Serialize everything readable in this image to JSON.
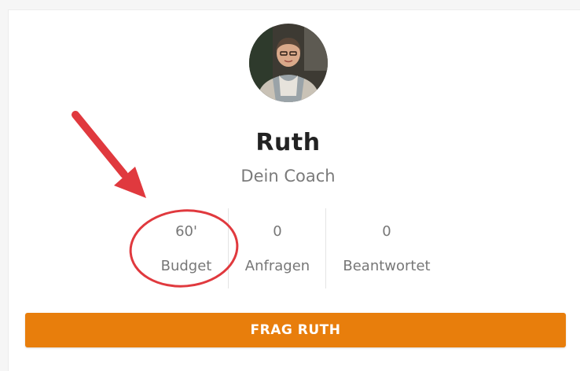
{
  "coach": {
    "name": "Ruth",
    "role": "Dein Coach"
  },
  "stats": [
    {
      "value": "60'",
      "label": "Budget"
    },
    {
      "value": "0",
      "label": "Anfragen"
    },
    {
      "value": "0",
      "label": "Beantwortet"
    }
  ],
  "cta": {
    "label": "FRAG RUTH"
  },
  "colors": {
    "accent": "#e87e0c",
    "annotation": "#e0393e"
  },
  "icons": {
    "avatar": "coach-avatar-photo",
    "annotation_arrow": "red-arrow-icon",
    "annotation_circle": "red-circle-highlight"
  }
}
